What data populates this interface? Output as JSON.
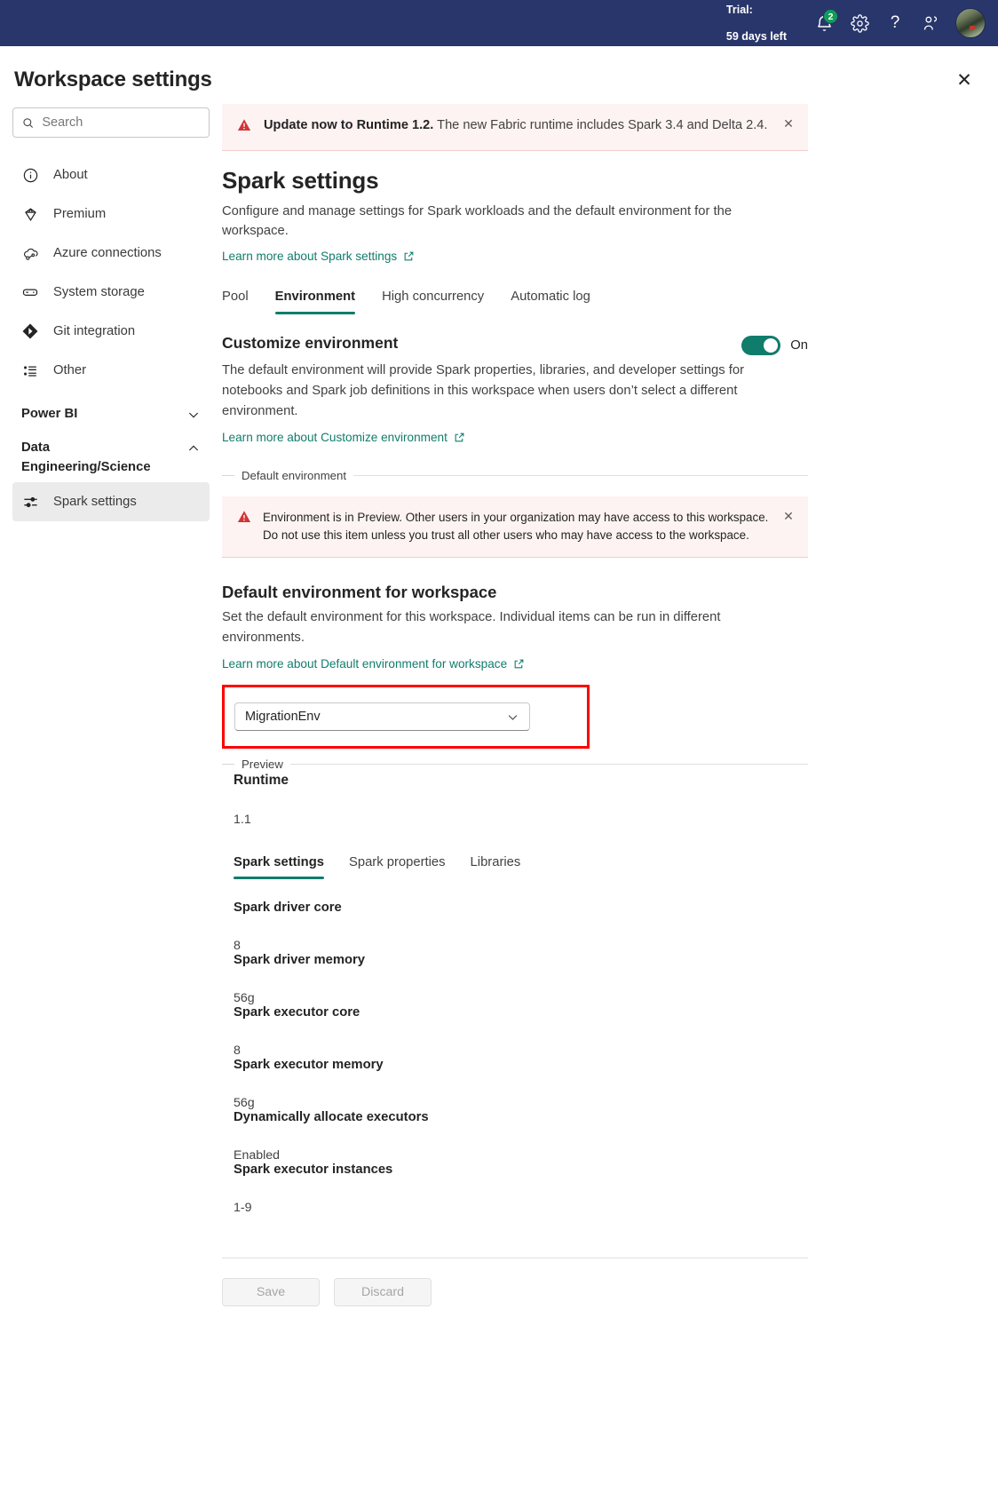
{
  "topbar": {
    "trial_line1": "Trial:",
    "trial_line2": "59 days left",
    "notification_count": "2",
    "icons": {
      "bell": "bell-icon",
      "gear": "gear-icon",
      "help": "?",
      "feedback": "feedback-icon"
    }
  },
  "header": {
    "title": "Workspace settings",
    "close_label": "✕"
  },
  "search": {
    "placeholder": "Search",
    "value": ""
  },
  "sidebar": {
    "items": [
      {
        "label": "About",
        "icon": "info-icon"
      },
      {
        "label": "Premium",
        "icon": "diamond-icon"
      },
      {
        "label": "Azure connections",
        "icon": "cloud-link-icon"
      },
      {
        "label": "System storage",
        "icon": "storage-icon"
      },
      {
        "label": "Git integration",
        "icon": "git-icon"
      },
      {
        "label": "Other",
        "icon": "list-icon"
      }
    ],
    "groups": [
      {
        "label": "Power BI",
        "expanded": false,
        "items": []
      },
      {
        "label": "Data Engineering/Science",
        "expanded": true,
        "items": [
          {
            "label": "Spark settings",
            "icon": "sliders-icon",
            "selected": true
          }
        ]
      }
    ]
  },
  "notice": {
    "bold": "Update now to Runtime 1.2.",
    "rest": " The new Fabric runtime includes Spark 3.4 and Delta 2.4.",
    "close_label": "✕"
  },
  "spark_settings": {
    "title": "Spark settings",
    "description": "Configure and manage settings for Spark workloads and the default environment for the workspace.",
    "learn_more": "Learn more about Spark settings",
    "tabs": [
      {
        "label": "Pool",
        "active": false
      },
      {
        "label": "Environment",
        "active": true
      },
      {
        "label": "High concurrency",
        "active": false
      },
      {
        "label": "Automatic log",
        "active": false
      }
    ]
  },
  "customize": {
    "heading": "Customize environment",
    "toggle_state": "On",
    "description": "The default environment will provide Spark properties, libraries, and developer settings for notebooks and Spark job definitions in this workspace when users don’t select a different environment.",
    "learn_more": "Learn more about Customize environment"
  },
  "default_environment_fieldset": {
    "legend": "Default environment",
    "warning": "Environment is in Preview. Other users in your organization may have access to this workspace. Do not use this item unless you trust all other users who may have access to the workspace.",
    "warning_close": "✕"
  },
  "default_env": {
    "heading": "Default environment for workspace",
    "description": "Set the default environment for this workspace. Individual items can be run in different environments.",
    "learn_more": "Learn more about Default environment for workspace",
    "select_value": "MigrationEnv",
    "highlight_color": "#ff0000"
  },
  "preview": {
    "legend": "Preview",
    "runtime_label": "Runtime",
    "runtime_value": "1.1",
    "tabs": [
      {
        "label": "Spark settings",
        "active": true
      },
      {
        "label": "Spark properties",
        "active": false
      },
      {
        "label": "Libraries",
        "active": false
      }
    ],
    "properties": [
      {
        "label": "Spark driver core",
        "value": "8"
      },
      {
        "label": "Spark driver memory",
        "value": "56g"
      },
      {
        "label": "Spark executor core",
        "value": "8"
      },
      {
        "label": "Spark executor memory",
        "value": "56g"
      },
      {
        "label": "Dynamically allocate executors",
        "value": "Enabled"
      },
      {
        "label": "Spark executor instances",
        "value": "1-9"
      }
    ]
  },
  "footer": {
    "save_label": "Save",
    "discard_label": "Discard"
  },
  "colors": {
    "topbar_bg": "#29366b",
    "accent": "#107c6b",
    "warning_bg": "#fdf3f2",
    "warning_icon": "#d13438",
    "badge": "#0f9d58"
  }
}
